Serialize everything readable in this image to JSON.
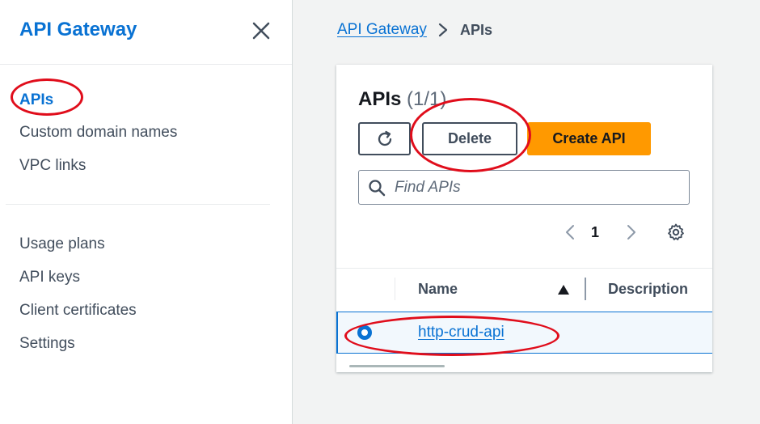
{
  "sidebar": {
    "title": "API Gateway",
    "close_icon": "close-icon",
    "items_primary": [
      {
        "label": "APIs",
        "active": true
      },
      {
        "label": "Custom domain names"
      },
      {
        "label": "VPC links"
      }
    ],
    "items_secondary": [
      {
        "label": "Usage plans"
      },
      {
        "label": "API keys"
      },
      {
        "label": "Client certificates"
      },
      {
        "label": "Settings"
      }
    ]
  },
  "breadcrumb": {
    "link": "API Gateway",
    "separator_icon": "chevron-right-icon",
    "current": "APIs"
  },
  "panel": {
    "title": "APIs",
    "count": "(1/1)",
    "refresh_icon": "refresh-icon",
    "delete_label": "Delete",
    "create_label": "Create API",
    "search_placeholder": "Find APIs",
    "search_value": "",
    "pagination": {
      "current_page": "1",
      "prev_icon": "chevron-left-icon",
      "next_icon": "chevron-right-icon"
    },
    "settings_icon": "gear-icon"
  },
  "table": {
    "columns": [
      "Name",
      "Description"
    ],
    "sort_icon": "sort-ascending-icon",
    "rows": [
      {
        "name": "http-crud-api",
        "description": "",
        "selected": true
      }
    ]
  },
  "colors": {
    "accent": "#0972d3",
    "primary_button": "#ff9900",
    "annotation": "#e00d1b",
    "main_background": "#f2f3f3"
  }
}
